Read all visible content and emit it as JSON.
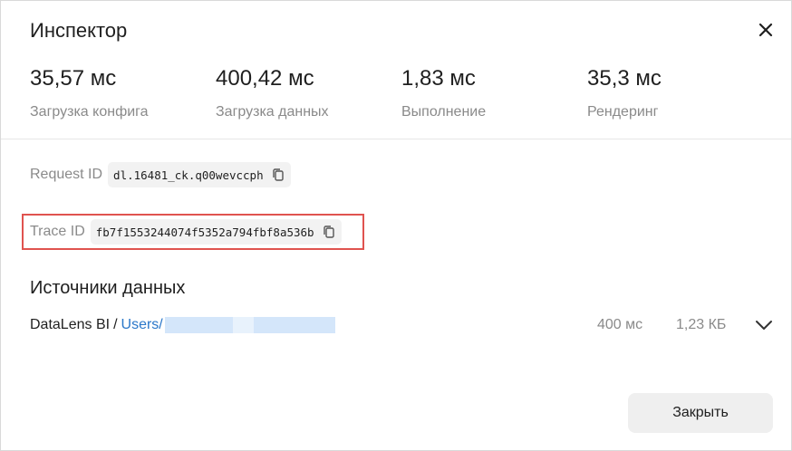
{
  "dialog": {
    "title": "Инспектор",
    "close_icon": "close-icon"
  },
  "metrics": [
    {
      "value": "35,57 мс",
      "label": "Загрузка конфига"
    },
    {
      "value": "400,42 мс",
      "label": "Загрузка данных"
    },
    {
      "value": "1,83 мс",
      "label": "Выполнение"
    },
    {
      "value": "35,3 мс",
      "label": "Рендеринг"
    }
  ],
  "request": {
    "label": "Request ID",
    "value": "dl.16481_ck.q00wevccph",
    "copy_icon": "copy-icon"
  },
  "trace": {
    "label": "Trace ID",
    "value": "fb7f1553244074f5352a794fbf8a536b",
    "copy_icon": "copy-icon",
    "highlight_color": "#e0534f"
  },
  "sources": {
    "title": "Источники данных",
    "items": [
      {
        "name": "DataLens BI",
        "separator": "/",
        "link": "Users/",
        "time": "400 мс",
        "size": "1,23 КБ",
        "expand_icon": "chevron-down-icon"
      }
    ]
  },
  "footer": {
    "close_label": "Закрыть"
  },
  "colors": {
    "link": "#2a77c9",
    "secondary_text": "#8a8a8a"
  }
}
